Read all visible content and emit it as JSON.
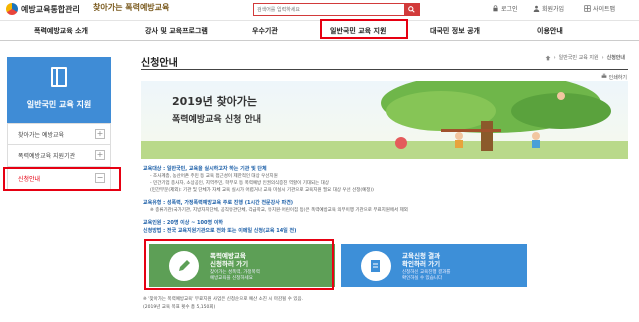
{
  "header": {
    "logo_text": "예방교육통합관리",
    "logo2_text": "찾아가는 폭력예방교육",
    "search_placeholder": "검색어를 입력하세요",
    "utils": [
      "로그인",
      "회원가입",
      "사이트맵"
    ]
  },
  "nav": {
    "items": [
      "폭력예방교육 소개",
      "강사 및 교육프로그램",
      "우수기관",
      "일반국민 교육 지원",
      "대국민 정보 공개",
      "이용안내"
    ]
  },
  "sidebar": {
    "title": "일반국민 교육 지원",
    "items": [
      {
        "label": "찾아가는 예방교육",
        "toggle": "+"
      },
      {
        "label": "폭력예방교육 지원기관",
        "toggle": "+"
      },
      {
        "label": "신청안내",
        "toggle": "−"
      }
    ]
  },
  "main": {
    "title": "신청안내",
    "breadcrumb": [
      "일반국민 교육 지원",
      "신청안내"
    ],
    "print_label": "인쇄하기",
    "banner_line1": "2019년 찾아가는",
    "banner_line2": "폭력예방교육 신청 안내",
    "info_lines": [
      {
        "text": "교육대상 : 일반국민, 교육을 실시하고자 하는 기관 및 단체",
        "style": "b"
      },
      {
        "text": "- 조사계층, 농산어촌 주민 등 교육 접근성이 제한적인 대상 우선지원",
        "style": ""
      },
      {
        "text": "- 민간기업 종사자, 소상공인, 지역주민, 학부모 등 폭력예방 인권의식증진 역할이 기대되는 대상",
        "style": ""
      },
      {
        "text": "(민간부문(제외): 기관 및 단체가 자체 교육 실시가 어렵거나 교육 미실시 기관으로 교육지원 필요 대상 우선 선정(예정))",
        "style": ""
      },
      {
        "text": "교육유형 : 성폭력, 가정폭력예방교육 주로 진행 (1시간 전문강사 파견)",
        "style": "b"
      },
      {
        "text": "※ 종류기관(국가기관, 지방자치단체, 공직유관단체, 각급학교, 유치원·어린이집 등)은 폭력예방교육 의무이행 기관으로 무료지원에서 제외",
        "style": ""
      },
      {
        "text": "교육인원 : 20명 이상 ~ 100명 이하",
        "style": "b"
      },
      {
        "text": "신청방법 : 전국 교육지원기관으로 전화 또는 이메일 신청(교육 14일 전)",
        "style": "b"
      }
    ],
    "card1": {
      "title1": "폭력예방교육",
      "title2": "신청하러 가기",
      "sub1": "찾아가는 성폭력, 가정폭력",
      "sub2": "예방교육을 신청하세요"
    },
    "card2": {
      "title1": "교육신청 결과",
      "title2": "확인하러 가기",
      "sub1": "신청하신 교육진행 결과를",
      "sub2": "확인하실 수 있습니다"
    },
    "notes": [
      "※ '찾아가는 폭력예방교육' 무료지원 사업은 신청순으로 예산 소진 시 마감될 수 있음.",
      "(2019년 교육 목표 횟수 총 5,150회)"
    ]
  },
  "colors": {
    "accent_red": "#e60012",
    "sidebar_blue": "#3f8cd6",
    "card_green": "#5d9f56",
    "card_blue": "#3d8fd8"
  }
}
